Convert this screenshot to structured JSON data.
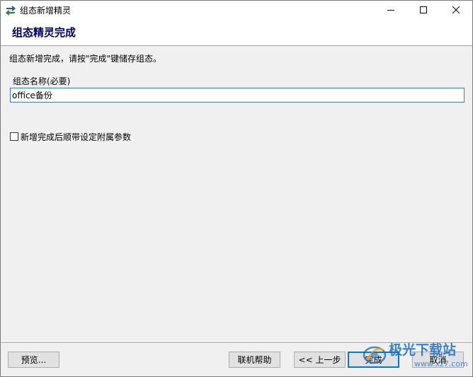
{
  "window": {
    "title": "组态新增精灵",
    "app_icon": "swap-arrows-icon",
    "controls": {
      "minimize_icon": "minimize-icon",
      "maximize_icon": "maximize-icon",
      "close_icon": "close-icon"
    }
  },
  "header": {
    "title": "组态精灵完成",
    "title_color": "#000066"
  },
  "content": {
    "instruction": "组态新增完成，请按\"完成\"键储存组态。",
    "name_field": {
      "label": "组态名称(必要)",
      "value": "office备份"
    },
    "checkbox": {
      "label": "新增完成后顺带设定附属参数",
      "checked": false
    }
  },
  "footer": {
    "preview_label": "预览...",
    "help_label": "联机帮助",
    "back_label": "<< 上一步",
    "finish_label": "完成",
    "cancel_label": "取消"
  },
  "watermark": {
    "text": "极光下载站",
    "url": "www.xz7.com",
    "color": "#1a6fc4"
  },
  "colors": {
    "accent": "#0078d7",
    "window_bg": "#f0f0f0",
    "input_border": "#3c78b4"
  }
}
